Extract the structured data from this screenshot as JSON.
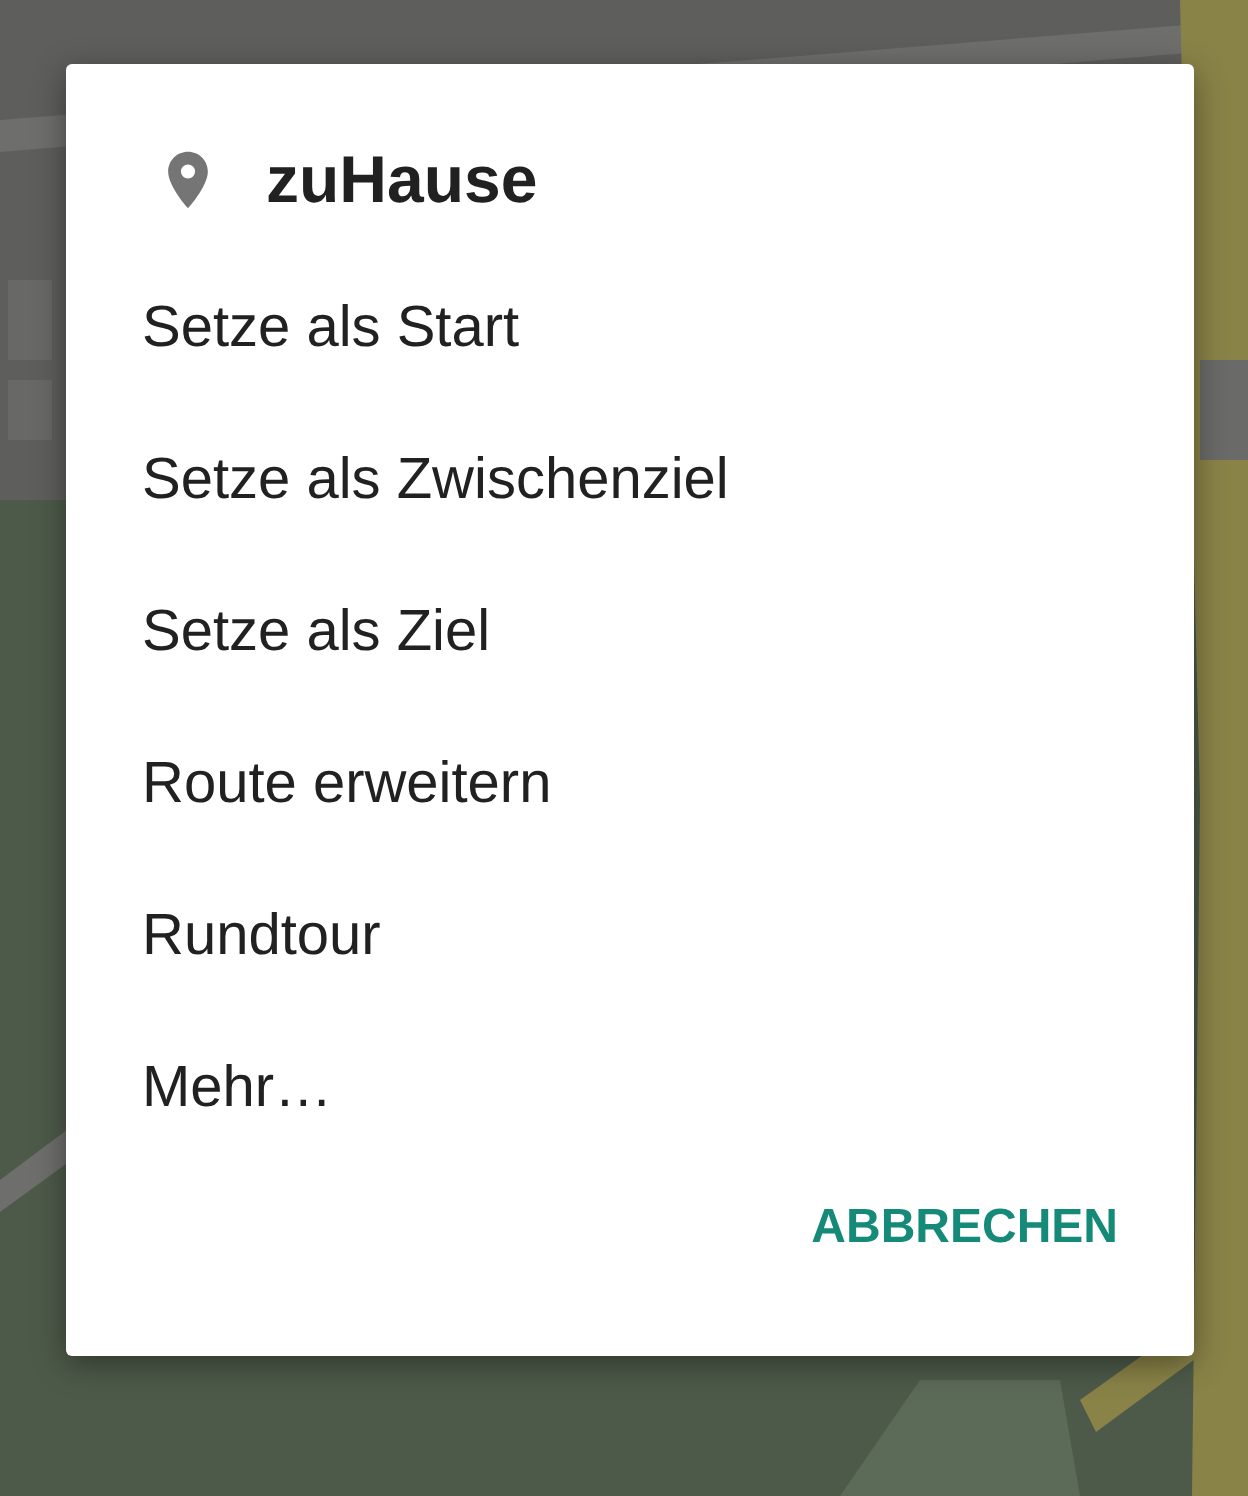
{
  "dialog": {
    "title": "zuHause",
    "items": [
      {
        "label": "Setze als Start"
      },
      {
        "label": "Setze als Zwischenziel"
      },
      {
        "label": "Setze als Ziel"
      },
      {
        "label": "Route erweitern"
      },
      {
        "label": "Rundtour"
      },
      {
        "label": "Mehr…"
      }
    ],
    "buttons": [
      {
        "label": "ABBRECHEN"
      }
    ]
  }
}
